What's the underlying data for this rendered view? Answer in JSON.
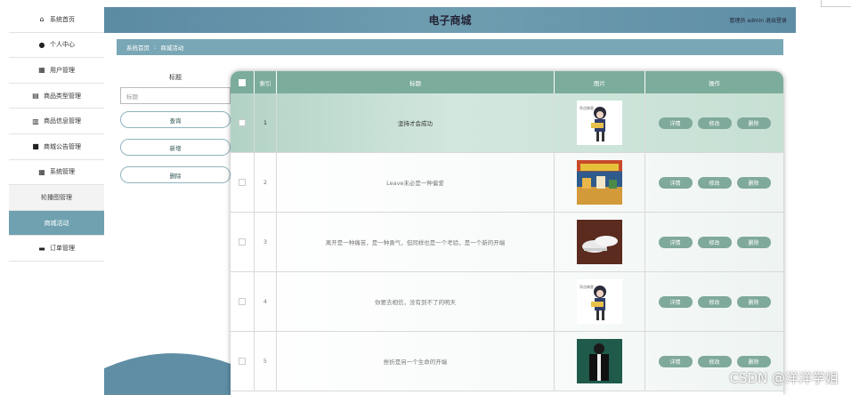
{
  "header": {
    "title": "电子商城",
    "user": "管理员 admin  退出登录"
  },
  "breadcrumb": {
    "home": "系统首页",
    "sep": ":",
    "current": "商城活动"
  },
  "sidebar": {
    "items": [
      {
        "label": "系统首页",
        "icon": "home-icon"
      },
      {
        "label": "个人中心",
        "icon": "user-icon"
      },
      {
        "label": "用户管理",
        "icon": "grid-icon"
      },
      {
        "label": "商品类型管理",
        "icon": "clipboard-icon"
      },
      {
        "label": "商品信息管理",
        "icon": "bar-chart-icon"
      },
      {
        "label": "商城公告管理",
        "icon": "briefcase-icon"
      },
      {
        "label": "系统管理",
        "icon": "grid-icon"
      },
      {
        "label": "轮播图管理",
        "icon": ""
      },
      {
        "label": "商城活动",
        "icon": ""
      },
      {
        "label": "订单管理",
        "icon": "monitor-icon"
      }
    ]
  },
  "search": {
    "label": "标题",
    "placeholder": "标题",
    "query_btn": "查询",
    "add_btn": "新增",
    "delete_btn": "删除"
  },
  "table": {
    "headers": [
      "",
      "索引",
      "标题",
      "图片",
      "操作"
    ],
    "actions": {
      "detail": "详情",
      "edit": "修改",
      "delete": "删除"
    },
    "rows": [
      {
        "index": "1",
        "title": "坚持才会成功",
        "image": "cartoon-girl"
      },
      {
        "index": "2",
        "title": "Leave未必是一种偏爱",
        "image": "toys-photo"
      },
      {
        "index": "3",
        "title": "离开是一种痛苦，是一种勇气，但同样也是一个考验，是一个新的开端",
        "image": "shoes-photo"
      },
      {
        "index": "4",
        "title": "你要去相信，没有到不了的明天",
        "image": "cartoon-girl"
      },
      {
        "index": "5",
        "title": "挫折是另一个生命的开端",
        "image": "jacket-photo"
      }
    ]
  },
  "watermark": "CSDN @洋洋学姐",
  "colors": {
    "accent": "#7cac9b",
    "header": "#5b8aa4",
    "active": "#6fa1b1"
  }
}
